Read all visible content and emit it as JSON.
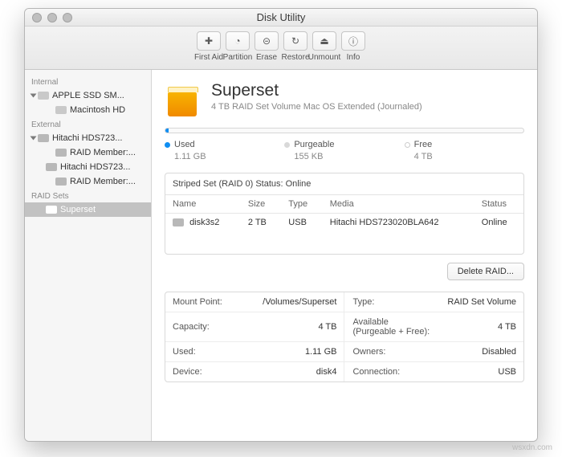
{
  "window": {
    "title": "Disk Utility"
  },
  "toolbar": [
    {
      "label": "First Aid",
      "glyph": "✚"
    },
    {
      "label": "Partition",
      "glyph": "◔"
    },
    {
      "label": "Erase",
      "glyph": "⊝"
    },
    {
      "label": "Restore",
      "glyph": "↻"
    },
    {
      "label": "Unmount",
      "glyph": "⏏"
    },
    {
      "label": "Info",
      "glyph": "ⓘ"
    }
  ],
  "sidebar": {
    "groups": [
      {
        "title": "Internal",
        "items": [
          {
            "label": "APPLE SSD SM...",
            "children": [
              {
                "label": "Macintosh HD"
              }
            ]
          }
        ]
      },
      {
        "title": "External",
        "items": [
          {
            "label": "Hitachi HDS723...",
            "children": [
              {
                "label": "RAID Member:..."
              }
            ]
          },
          {
            "label": "Hitachi HDS723...",
            "children": [
              {
                "label": "RAID Member:..."
              }
            ]
          }
        ]
      },
      {
        "title": "RAID Sets",
        "items": [
          {
            "label": "Superset",
            "selected": true
          }
        ]
      }
    ]
  },
  "volume": {
    "name": "Superset",
    "subtitle": "4 TB RAID Set Volume Mac OS Extended (Journaled)"
  },
  "usage": {
    "used": {
      "label": "Used",
      "value": "1.11 GB",
      "color": "#0f8ef2"
    },
    "purgeable": {
      "label": "Purgeable",
      "value": "155 KB",
      "color": "#d9d9d9"
    },
    "free": {
      "label": "Free",
      "value": "4 TB",
      "color": "#ffffff"
    }
  },
  "raid": {
    "header": "Striped Set (RAID 0) Status: Online",
    "cols": {
      "name": "Name",
      "size": "Size",
      "type": "Type",
      "media": "Media",
      "status": "Status"
    },
    "rows": [
      {
        "name": "disk3s2",
        "size": "2 TB",
        "type": "USB",
        "media": "Hitachi HDS723020BLA642",
        "status": "Online"
      }
    ]
  },
  "buttons": {
    "delete_raid": "Delete RAID..."
  },
  "details": {
    "left": [
      {
        "k": "Mount Point:",
        "v": "/Volumes/Superset"
      },
      {
        "k": "Capacity:",
        "v": "4 TB"
      },
      {
        "k": "Used:",
        "v": "1.11 GB"
      },
      {
        "k": "Device:",
        "v": "disk4"
      }
    ],
    "right": [
      {
        "k": "Type:",
        "v": "RAID Set Volume"
      },
      {
        "k": "Available (Purgeable + Free):",
        "v": "4 TB"
      },
      {
        "k": "Owners:",
        "v": "Disabled"
      },
      {
        "k": "Connection:",
        "v": "USB"
      }
    ]
  },
  "watermark": "wsxdn.com"
}
